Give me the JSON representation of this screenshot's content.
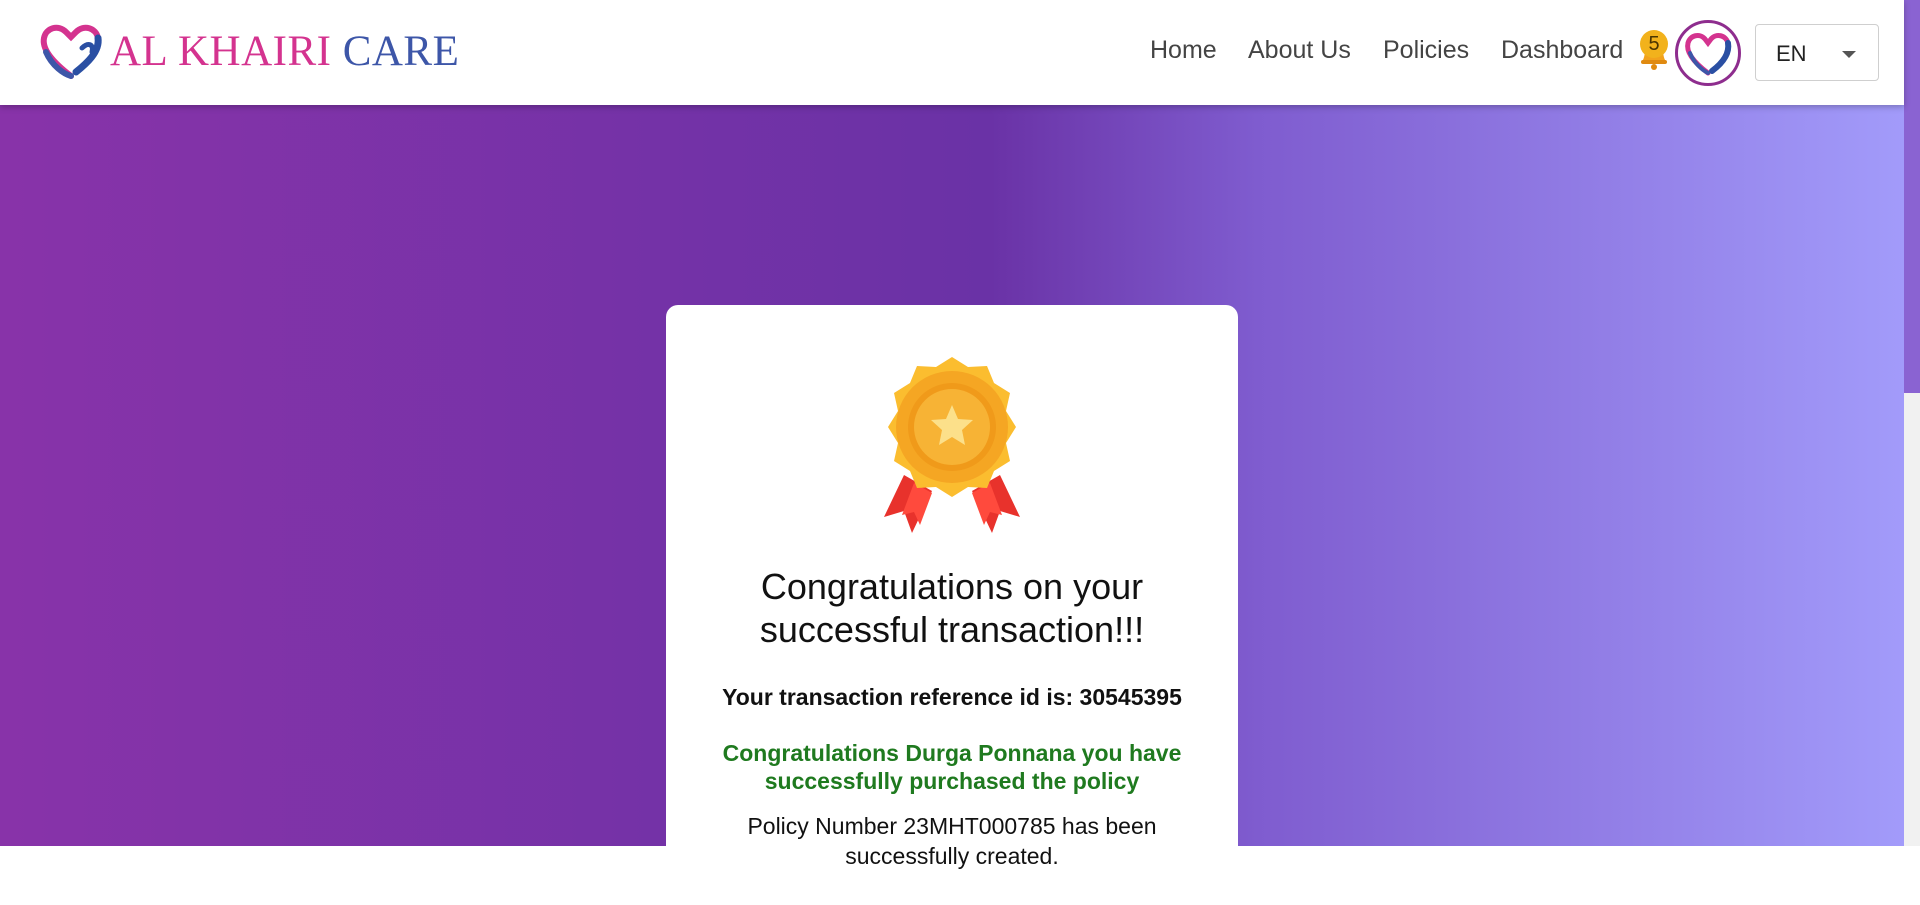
{
  "brand": {
    "name_part1": "AL KHAIRI",
    "name_part2": "CARE",
    "primary_color": "#d4338f",
    "secondary_color": "#3d56a8"
  },
  "nav": {
    "items": [
      {
        "label": "Home"
      },
      {
        "label": "About Us"
      },
      {
        "label": "Policies"
      },
      {
        "label": "Dashboard"
      }
    ],
    "notification_icon": "bell-icon",
    "notification_count": "5",
    "language": "EN"
  },
  "confirmation": {
    "icon": "medal-icon",
    "title": "Congratulations on your successful transaction!!!",
    "reference_line": "Your transaction reference id is: 30545395",
    "success_message": "Congratulations Durga Ponnana you have successfully purchased the policy",
    "policy_message": "Policy Number 23MHT000785 has been successfully created.",
    "success_color": "#1f7a1f"
  }
}
